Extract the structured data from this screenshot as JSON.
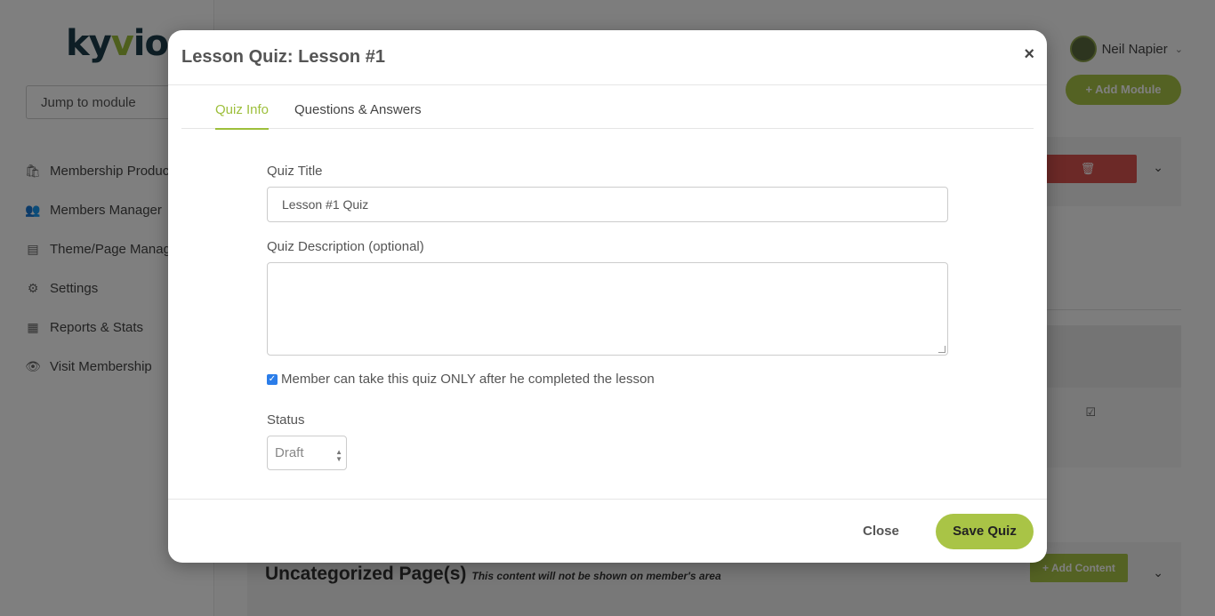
{
  "app": {
    "logo_main": "ky",
    "logo_accent": "v",
    "logo_end": "io"
  },
  "sidebar": {
    "jump_placeholder": "Jump to module",
    "items": [
      {
        "label": "Membership Products",
        "icon": "bag-icon"
      },
      {
        "label": "Members Manager",
        "icon": "users-icon"
      },
      {
        "label": "Theme/Page Manager",
        "icon": "page-icon"
      },
      {
        "label": "Settings",
        "icon": "gear-icon"
      },
      {
        "label": "Reports & Stats",
        "icon": "report-icon"
      },
      {
        "label": "Visit Membership",
        "icon": "eye-icon"
      }
    ]
  },
  "header": {
    "user_name": "Neil Napier"
  },
  "main": {
    "add_module_label": "+ Add Module",
    "uncategorized_title": "Uncategorized Page(s)",
    "uncategorized_note": "This content will not be shown on member's area",
    "add_content_label": "+ Add Content"
  },
  "modal": {
    "title": "Lesson Quiz: Lesson #1",
    "close_x": "×",
    "tabs": [
      {
        "label": "Quiz Info",
        "active": true
      },
      {
        "label": "Questions & Answers",
        "active": false
      }
    ],
    "quiz_title_label": "Quiz Title",
    "quiz_title_value": "Lesson #1 Quiz",
    "description_label": "Quiz Description (optional)",
    "description_value": "",
    "checkbox_label": "Member can take this quiz ONLY after he completed the lesson",
    "checkbox_checked": true,
    "status_label": "Status",
    "status_value": "Draft",
    "close_button": "Close",
    "save_button": "Save Quiz"
  },
  "colors": {
    "accent": "#a9c446",
    "tab_active": "#9dbf3b",
    "danger": "#d9534f",
    "checkbox": "#2b7de9"
  }
}
